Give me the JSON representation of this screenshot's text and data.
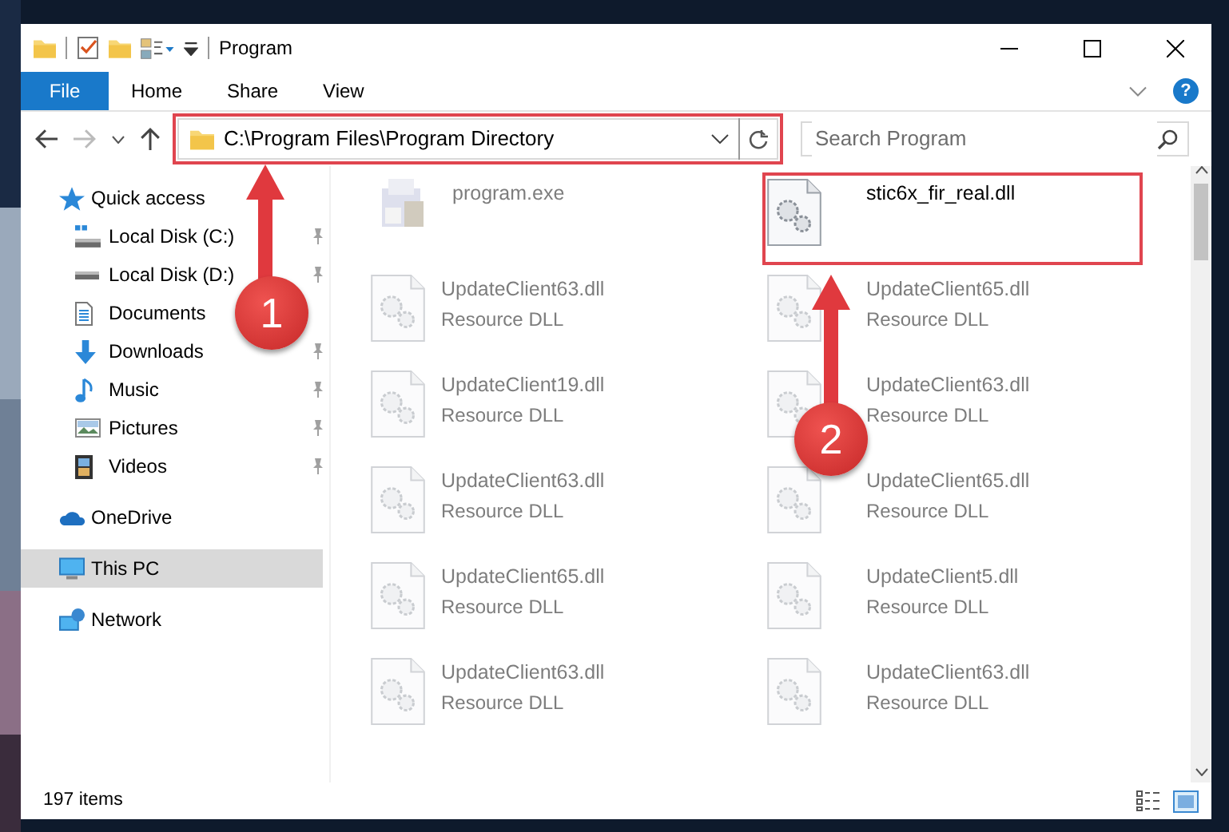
{
  "window": {
    "title": "Program"
  },
  "ribbon": {
    "tabs": [
      {
        "label": "File",
        "kind": "file"
      },
      {
        "label": "Home",
        "kind": "tab"
      },
      {
        "label": "Share",
        "kind": "tab"
      },
      {
        "label": "View",
        "kind": "tab"
      }
    ],
    "help": "?"
  },
  "address": {
    "path": "C:\\Program Files\\Program Directory"
  },
  "search": {
    "placeholder": "Search Program"
  },
  "sidebar": {
    "items": [
      {
        "label": "Quick access",
        "kind": "star",
        "selected": false,
        "children": [
          {
            "label": "Local Disk (C:)",
            "kind": "sysdrive",
            "pinned": true,
            "selected": false
          },
          {
            "label": "Local Disk (D:)",
            "kind": "drive",
            "pinned": true,
            "selected": false
          },
          {
            "label": "Documents",
            "kind": "document",
            "pinned": false,
            "selected": false
          },
          {
            "label": "Downloads",
            "kind": "download",
            "pinned": true,
            "selected": false
          },
          {
            "label": "Music",
            "kind": "music",
            "pinned": true,
            "selected": false
          },
          {
            "label": "Pictures",
            "kind": "pictures",
            "pinned": true,
            "selected": false
          },
          {
            "label": "Videos",
            "kind": "videos",
            "pinned": true,
            "selected": false
          }
        ]
      },
      {
        "label": "OneDrive",
        "kind": "cloud",
        "selected": false
      },
      {
        "label": "This PC",
        "kind": "computer",
        "selected": true
      },
      {
        "label": "Network",
        "kind": "network",
        "selected": false
      }
    ]
  },
  "files": [
    {
      "name": "program.exe",
      "kind": "app",
      "dimmed": true,
      "highlighted": false
    },
    {
      "name": "stic6x_fir_real.dll",
      "kind": "dll",
      "dimmed": false,
      "highlighted": true
    },
    {
      "name": "UpdateClient63.dll",
      "type": "Resource DLL",
      "kind": "dll",
      "dimmed": true,
      "highlighted": false
    },
    {
      "name": "UpdateClient65.dll",
      "type": "Resource DLL",
      "kind": "dll",
      "dimmed": true,
      "highlighted": false
    },
    {
      "name": "UpdateClient19.dll",
      "type": "Resource DLL",
      "kind": "dll",
      "dimmed": true,
      "highlighted": false
    },
    {
      "name": "UpdateClient63.dll",
      "type": "Resource DLL",
      "kind": "dll",
      "dimmed": true,
      "highlighted": false
    },
    {
      "name": "UpdateClient63.dll",
      "type": "Resource DLL",
      "kind": "dll",
      "dimmed": true,
      "highlighted": false
    },
    {
      "name": "UpdateClient65.dll",
      "type": "Resource DLL",
      "kind": "dll",
      "dimmed": true,
      "highlighted": false
    },
    {
      "name": "UpdateClient65.dll",
      "type": "Resource DLL",
      "kind": "dll",
      "dimmed": true,
      "highlighted": false
    },
    {
      "name": "UpdateClient5.dll",
      "type": "Resource DLL",
      "kind": "dll",
      "dimmed": true,
      "highlighted": false
    },
    {
      "name": "UpdateClient63.dll",
      "type": "Resource DLL",
      "kind": "dll",
      "dimmed": true,
      "highlighted": false
    },
    {
      "name": "UpdateClient63.dll",
      "type": "Resource DLL",
      "kind": "dll",
      "dimmed": true,
      "highlighted": false
    }
  ],
  "status_bar": {
    "text": "197 items"
  },
  "annotations": [
    {
      "number": "1"
    },
    {
      "number": "2"
    }
  ]
}
